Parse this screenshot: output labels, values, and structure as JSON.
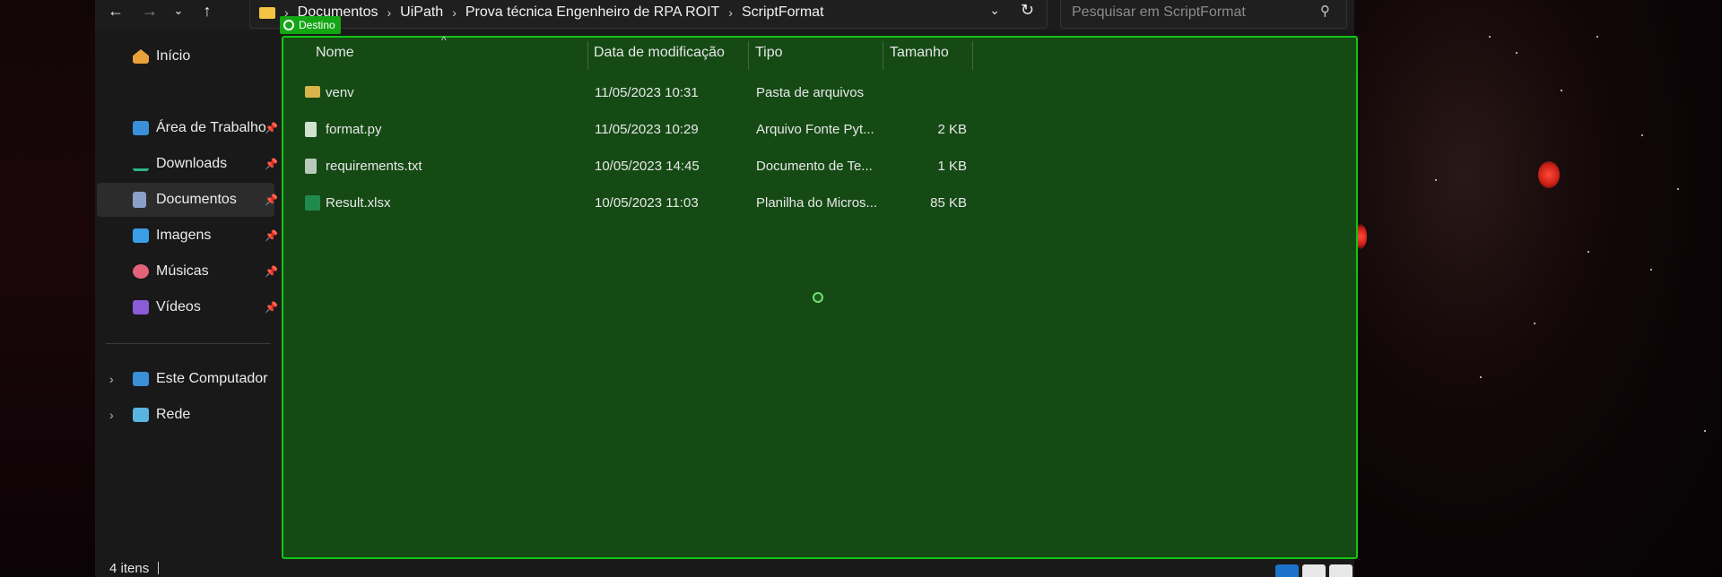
{
  "window": {
    "breadcrumb": [
      "Documentos",
      "UiPath",
      "Prova técnica Engenheiro de RPA ROIT",
      "ScriptFormat"
    ],
    "search_placeholder": "Pesquisar em ScriptFormat"
  },
  "nav": {
    "back_icon": "arrow-left-icon",
    "forward_icon": "arrow-right-icon",
    "recent_icon": "chevron-down-icon",
    "up_icon": "arrow-up-icon"
  },
  "sidebar": {
    "home": "Início",
    "pinned": [
      {
        "label": "Área de Trabalho",
        "icon": "desktop-icon",
        "color": "#3a8fd8"
      },
      {
        "label": "Downloads",
        "icon": "download-icon",
        "color": "#2fb38a"
      },
      {
        "label": "Documentos",
        "icon": "documents-icon",
        "color": "#8aa0c8"
      },
      {
        "label": "Imagens",
        "icon": "images-icon",
        "color": "#3a9ee8"
      },
      {
        "label": "Músicas",
        "icon": "music-icon",
        "color": "#e2637a"
      },
      {
        "label": "Vídeos",
        "icon": "videos-icon",
        "color": "#8a5cd8"
      }
    ],
    "this_pc": "Este Computador",
    "network": "Rede"
  },
  "overlay": {
    "badge": "Destino",
    "accent": "#16c416",
    "fill": "#154a15"
  },
  "columns": {
    "name": "Nome",
    "modified": "Data de modificação",
    "type": "Tipo",
    "size": "Tamanho"
  },
  "files": [
    {
      "name": "venv",
      "modified": "11/05/2023 10:31",
      "type": "Pasta de arquivos",
      "size": "",
      "icon": "folder-icon"
    },
    {
      "name": "format.py",
      "modified": "11/05/2023 10:29",
      "type": "Arquivo Fonte Pyt...",
      "size": "2 KB",
      "icon": "python-file-icon"
    },
    {
      "name": "requirements.txt",
      "modified": "10/05/2023 14:45",
      "type": "Documento de Te...",
      "size": "1 KB",
      "icon": "text-file-icon"
    },
    {
      "name": "Result.xlsx",
      "modified": "10/05/2023 11:03",
      "type": "Planilha do Micros...",
      "size": "85 KB",
      "icon": "excel-file-icon"
    }
  ],
  "status": {
    "count": "4 itens"
  }
}
